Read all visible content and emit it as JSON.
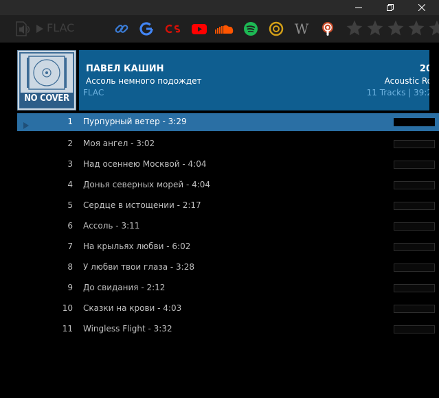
{
  "window": {
    "controls": [
      "minimize",
      "restore",
      "close"
    ]
  },
  "toolbar": {
    "format_label": "FLAC",
    "icons": [
      "audio-file-icon",
      "link-icon",
      "google-icon",
      "lastfm-icon",
      "youtube-icon",
      "soundcloud-icon",
      "spotify-icon",
      "discogs-icon",
      "wikipedia-icon",
      "podcast-icon"
    ],
    "rating": 0,
    "rating_max": 5,
    "colors": {
      "google": "#4285F4",
      "lastfm": "#d51007",
      "youtube": "#ff0000",
      "soundcloud": "#ff5500",
      "spotify": "#1db954",
      "discogs": "#d4a017",
      "link": "#3b7dd8"
    }
  },
  "album": {
    "cover_text": "NO COVER",
    "artist": "ПАВЕЛ КАШИН",
    "title": "Ассоль немного подождет",
    "format": "FLAC",
    "year": "20",
    "genre": "Acoustic Ro",
    "tracks_info": "11 Tracks | 39:2",
    "accent": "#0f5e90"
  },
  "tracks": [
    {
      "num": "1",
      "title": "Пурпурный ветер - 3:29",
      "selected": true
    },
    {
      "num": "2",
      "title": "Моя ангел - 3:02"
    },
    {
      "num": "3",
      "title": "Над осеннею Москвой - 4:04"
    },
    {
      "num": "4",
      "title": "Донья северных морей - 4:04"
    },
    {
      "num": "5",
      "title": "Сердце в истощении - 2:17"
    },
    {
      "num": "6",
      "title": "Ассоль - 3:11"
    },
    {
      "num": "7",
      "title": "На крыльях любви - 6:02"
    },
    {
      "num": "8",
      "title": "У любви твои глаза - 3:28"
    },
    {
      "num": "9",
      "title": "До свидания - 2:12"
    },
    {
      "num": "10",
      "title": "Сказки на крови - 4:03"
    },
    {
      "num": "11",
      "title": "Wingless Flight - 3:32"
    }
  ]
}
